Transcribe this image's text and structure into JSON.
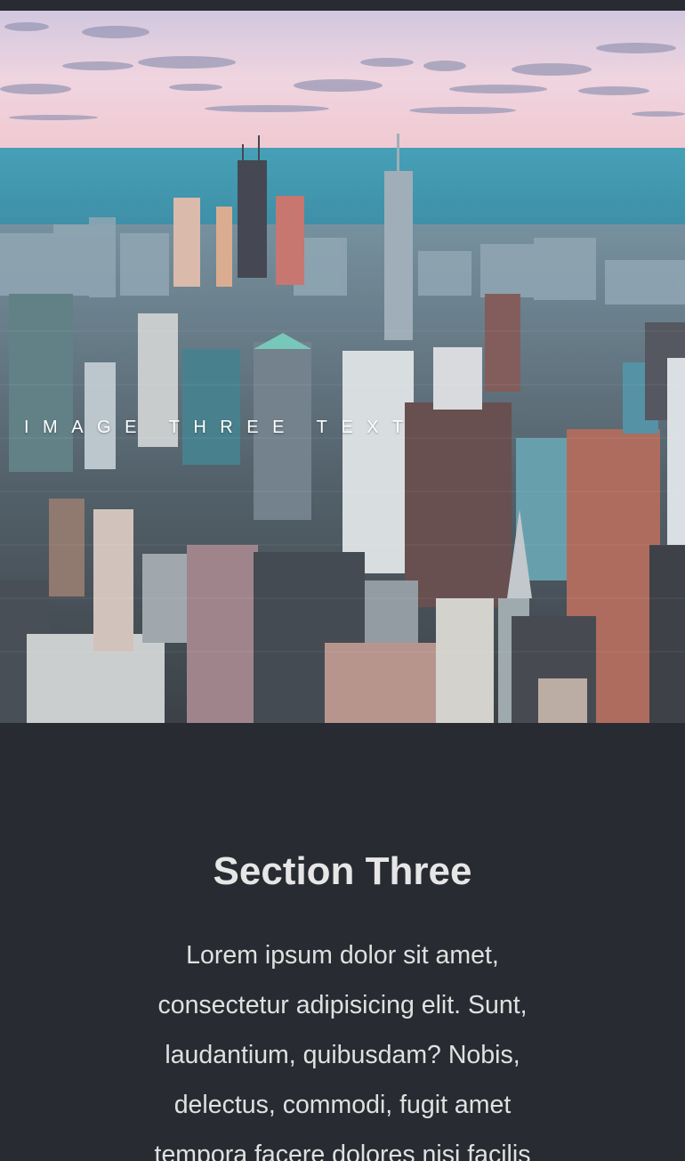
{
  "hero": {
    "caption": "IMAGE THREE TEXT",
    "image_alt": "city-skyline-photo"
  },
  "section": {
    "title": "Section Three",
    "body": "Lorem ipsum dolor sit amet, consectetur adipisicing elit. Sunt, laudantium, quibusdam? Nobis, delectus, commodi, fugit amet tempora facere dolores nisi facilis"
  },
  "colors": {
    "background": "#282b31",
    "heading": "#e6e6e6",
    "body_text": "#e0e0e0",
    "caption": "#ffffff"
  }
}
